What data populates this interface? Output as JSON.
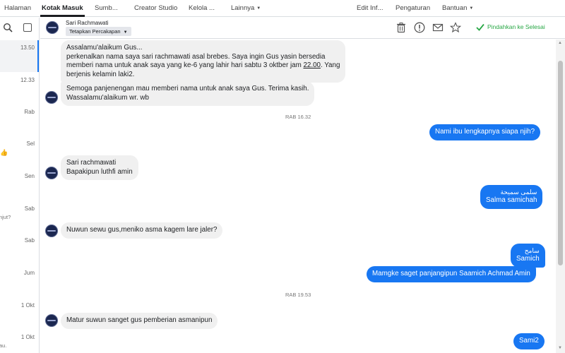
{
  "nav": {
    "tabs": [
      "Halaman",
      "Kotak Masuk",
      "Sumb...",
      "Creator Studio",
      "Kelola ...",
      "Lainnya"
    ],
    "right": [
      "Edit Inf...",
      "Pengaturan",
      "Bantuan"
    ]
  },
  "threads": {
    "timestamps": [
      "13.50",
      "12.33",
      "Rab",
      "Sel",
      "Sen",
      "Sab",
      "Sab",
      "Jum",
      "1 Okt",
      "1 Okt"
    ],
    "fragments": [
      "njut?",
      "au."
    ],
    "thumb": "👍"
  },
  "header": {
    "name": "Sari Rachmawati",
    "assign_label": "Tetapkan Percakapan",
    "done_label": "Pindahkan ke Selesai"
  },
  "messages": {
    "m1": {
      "l1": "Assalamu'alaikum Gus...",
      "l2": "perkenalkan nama saya sari rachmawati asal brebes. Saya ingin Gus yasin bersedia",
      "l3a": "memberi nama untuk anak saya yang ke-6 yang lahir hari sabtu 3 oktber jam ",
      "l3b": "22.00",
      "l3c": ". Yang",
      "l4": "berjenis kelamin laki2."
    },
    "m2": {
      "l1": "Semoga panjenengan mau memberi nama untuk anak saya Gus. Terima kasih.",
      "l2": "Wassalamu'alaikum wr. wb"
    },
    "sep1": "RAB 16.32",
    "m3": "Nami ibu lengkapnya siapa njih?",
    "m4": {
      "l1": "Sari rachmawati",
      "l2": "Bapakipun luthfi amin"
    },
    "m5": {
      "arabic": "سلمى سميحة",
      "l2": "Salma samichah"
    },
    "m6": "Nuwun sewu gus,meniko asma kagem lare jaler?",
    "m7": {
      "arabic": "سامح",
      "l2": "Samich"
    },
    "m8": "Mamgke saget panjangipun Saamich Achmad Amin",
    "sep2": "RAB 19.53",
    "m9": "Matur suwun sanget gus pemberian asmanipun",
    "m10": "Sami2"
  },
  "colors": {
    "outgoing": "#1877f2",
    "incoming": "#f0f0f0",
    "done": "#28a745"
  }
}
